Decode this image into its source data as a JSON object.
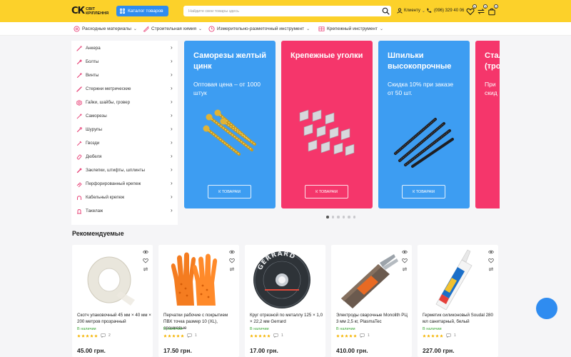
{
  "header": {
    "logo_mark": "СК",
    "logo_line1": "СВІТ",
    "logo_line2": "КРІПЛЕННЯ",
    "catalog_label": "Каталог товаров",
    "search_placeholder": "Найдите свои товары здесь",
    "client_label": "Клиенту",
    "phone": "(096) 329 40 06",
    "icons": [
      "user-icon",
      "phone-icon",
      "heart-icon",
      "compare-icon",
      "cart-icon"
    ],
    "badges": {
      "favorites": "0",
      "compare": "0",
      "cart": "0"
    }
  },
  "nav": {
    "items": [
      {
        "label": "Расходные материалы",
        "icon": "disc-icon"
      },
      {
        "label": "Строительная химия",
        "icon": "tube-icon"
      },
      {
        "label": "Измерительно-разметочный инструмент",
        "icon": "tape-icon"
      },
      {
        "label": "Крепежный инструмент",
        "icon": "tool-icon"
      }
    ]
  },
  "sidebar": {
    "items": [
      {
        "label": "Анкера"
      },
      {
        "label": "Болты"
      },
      {
        "label": "Винты"
      },
      {
        "label": "Стержни метрические"
      },
      {
        "label": "Гайки, шайбы, гровер"
      },
      {
        "label": "Саморезы"
      },
      {
        "label": "Шурупы"
      },
      {
        "label": "Гвозди"
      },
      {
        "label": "Дюбеля"
      },
      {
        "label": "Заклепки, штифты, шплинты"
      },
      {
        "label": "Перфорированный крепеж"
      },
      {
        "label": "Кабельный крепеж"
      },
      {
        "label": "Такелаж"
      }
    ]
  },
  "banners": [
    {
      "title_line1": "Саморезы желтый",
      "title_line2": "цинк",
      "subtitle_line1": "Оптовая цена – от 1000",
      "subtitle_line2": "штук",
      "button": "К ТОВАРАМ",
      "color": "#3d9df2"
    },
    {
      "title_line1": "Крепежные уголки",
      "title_line2": "",
      "subtitle_line1": "",
      "subtitle_line2": "",
      "button": "К ТОВАРАМ",
      "color": "#f5366b"
    },
    {
      "title_line1": "Шпильки",
      "title_line2": "высокопрочные",
      "subtitle_line1": "Скидка 10% при заказе",
      "subtitle_line2": "от 50 шт.",
      "button": "К ТОВАРАМ",
      "color": "#3d9df2"
    },
    {
      "title_line1": "Стал",
      "title_line2": "(тро",
      "subtitle_line1": "При",
      "subtitle_line2": "скид",
      "button": "",
      "color": "#f5366b"
    }
  ],
  "carousel": {
    "active": 1,
    "total": 6
  },
  "recommended": {
    "title": "Рекомендуемые",
    "products": [
      {
        "name": "Скотч упаковочный 45 мм × 40 мм × 200 метров прозрачный",
        "stock": "В наличии",
        "rating": 5,
        "reviews": "2",
        "price": "45.00 грн."
      },
      {
        "name": "Перчатки рабочие с покрытием ПВХ точка размер 10 (XL), оранжевые",
        "stock": "В наличии",
        "rating": 5,
        "reviews": "1",
        "price": "17.50 грн."
      },
      {
        "name": "Круг отрезной по металлу 125 × 1,0 × 22,2 мм Gerrard",
        "stock": "В наличии",
        "rating": 5,
        "reviews": "1",
        "price": "17.00 грн."
      },
      {
        "name": "Электроды сварочные Monolith РЦ 3 мм 2,5 кг, PlasmaTec",
        "stock": "В наличии",
        "rating": 5,
        "reviews": "1",
        "price": "410.00 грн."
      },
      {
        "name": "Герметик силиконовый Soudal 280 мл санитарный, белый",
        "stock": "В наличии",
        "rating": 5,
        "reviews": "1",
        "price": "227.00 грн."
      }
    ],
    "disc_brand": "GERRARD"
  },
  "colors": {
    "header_yellow": "#fcd12a",
    "accent_blue": "#2f8cf0",
    "banner_blue": "#3d9df2",
    "banner_pink": "#f5366b",
    "stock_green": "#3aa635",
    "star_gold": "#f5b400"
  }
}
